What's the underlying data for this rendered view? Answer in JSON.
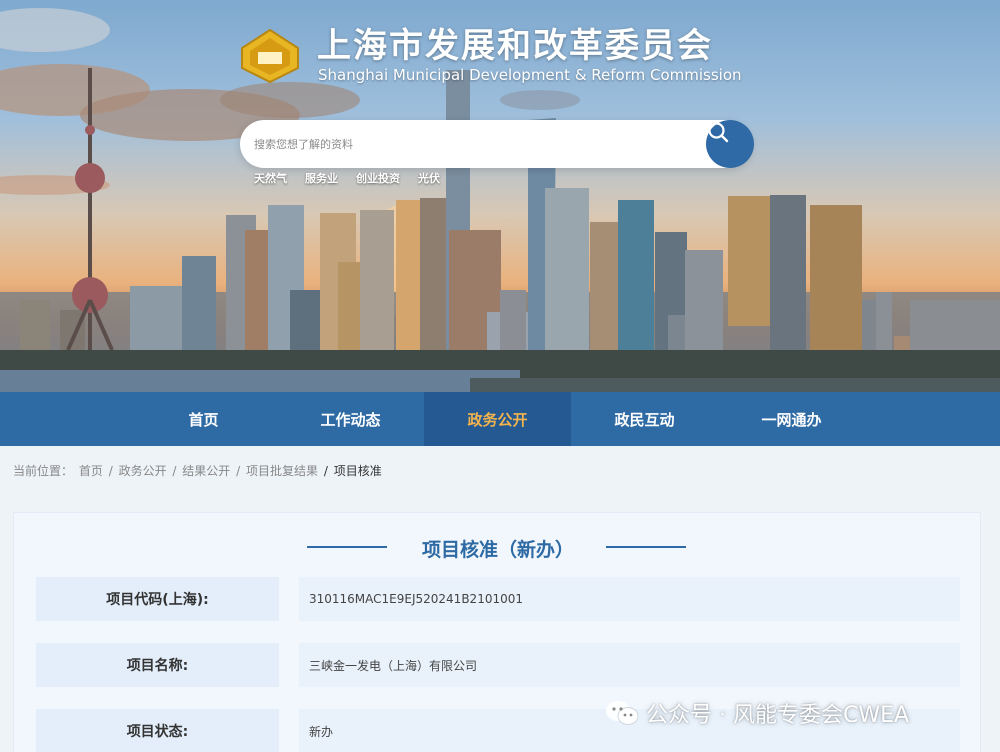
{
  "header": {
    "title": "上海市发展和改革委员会",
    "subtitle": "Shanghai Municipal Development & Reform Commission",
    "logo_text": "山"
  },
  "search": {
    "placeholder": "搜索您想了解的资料",
    "hot_words": [
      "天然气",
      "服务业",
      "创业投资",
      "光伏"
    ]
  },
  "nav": {
    "items": [
      {
        "label": "首页"
      },
      {
        "label": "工作动态"
      },
      {
        "label": "政务公开",
        "active": true
      },
      {
        "label": "政民互动"
      },
      {
        "label": "一网通办"
      }
    ]
  },
  "breadcrumb": {
    "prefix": "当前位置：",
    "items": [
      "首页",
      "政务公开",
      "结果公开",
      "项目批复结果"
    ],
    "separator": "/",
    "current": "项目核准"
  },
  "detail": {
    "title": "项目核准（新办）",
    "rows": [
      {
        "label": "项目代码(上海):",
        "value": "310116MAC1E9EJ520241B2101001"
      },
      {
        "label": "项目名称:",
        "value": "三峡金一发电（上海）有限公司"
      },
      {
        "label": "项目状态:",
        "value": "新办"
      }
    ]
  },
  "watermark": {
    "text": "公众号 · 风能专委会CWEA"
  },
  "colors": {
    "nav_bg": "#2e6aa3",
    "nav_active_text": "#f3b34f",
    "accent": "#2e6aa3"
  }
}
